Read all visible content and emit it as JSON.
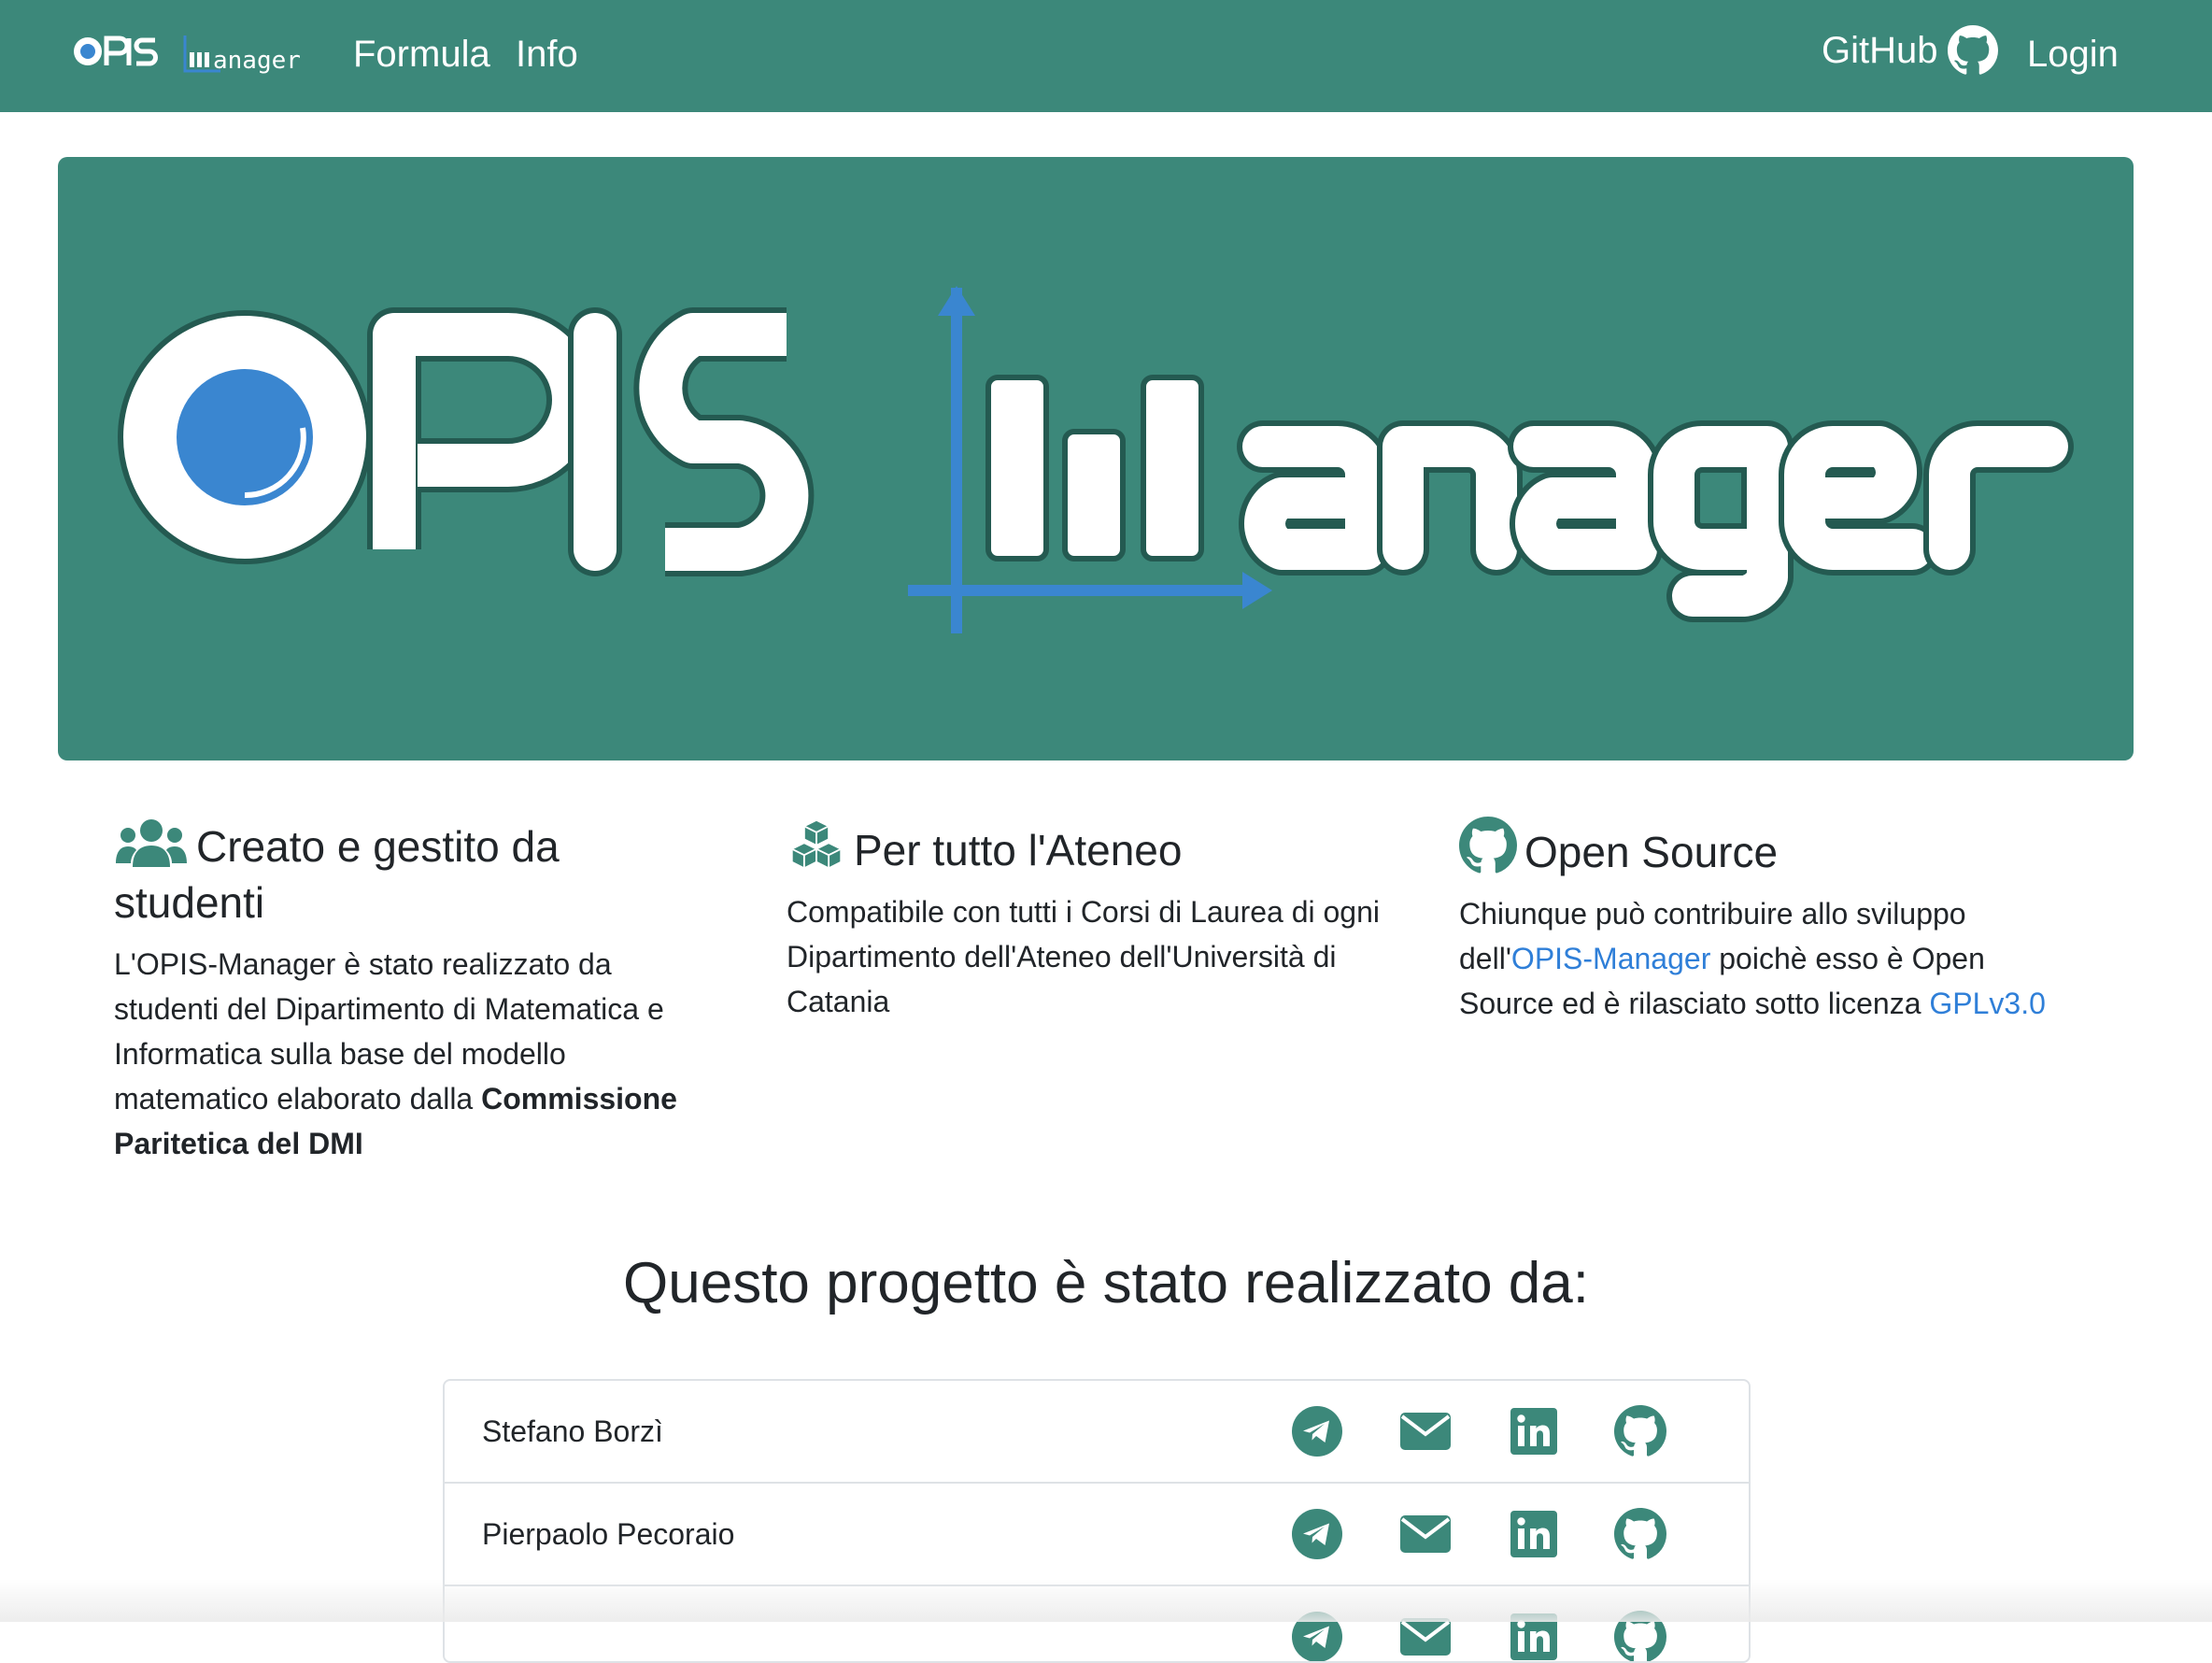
{
  "navbar": {
    "brand_logo": "opis-manager-logo",
    "links": [
      {
        "label": "Formula"
      },
      {
        "label": "Info"
      }
    ],
    "github_label": "GitHub",
    "login_label": "Login"
  },
  "hero": {
    "logo": "opis-manager-logo"
  },
  "features": [
    {
      "icon": "users-icon",
      "title": "Creato e gestito da studenti",
      "text_before": "L'OPIS-Manager è stato realizzato da studenti del Dipartimento di Matematica e Informatica sulla base del modello matematico elaborato dalla ",
      "text_bold": "Commissione Paritetica del DMI"
    },
    {
      "icon": "cubes-icon",
      "title": "Per tutto l'Ateneo",
      "text": "Compatibile con tutti i Corsi di Laurea di ogni Dipartimento dell'Ateneo dell'Università di Catania"
    },
    {
      "icon": "github-icon",
      "title": "Open Source",
      "text_before": "Chiunque può contribuire allo sviluppo dell'",
      "link1": "OPIS-Manager",
      "text_middle": " poichè esso è Open Source ed è rilasciato sotto licenza ",
      "link2": "GPLv3.0"
    }
  ],
  "team": {
    "title": "Questo progetto è stato realizzato da:",
    "members": [
      {
        "name": "Stefano Borzì",
        "icons": [
          "telegram-icon",
          "envelope-icon",
          "linkedin-icon",
          "github-icon"
        ]
      },
      {
        "name": "Pierpaolo Pecoraio",
        "icons": [
          "telegram-icon",
          "envelope-icon",
          "linkedin-icon",
          "github-icon"
        ]
      },
      {
        "name": "",
        "icons": [
          "telegram-icon",
          "envelope-icon",
          "linkedin-icon",
          "github-icon"
        ]
      }
    ]
  },
  "colors": {
    "primary": "#3c887a",
    "link": "#2f7fd8",
    "logo_blue": "#3a86d0"
  }
}
